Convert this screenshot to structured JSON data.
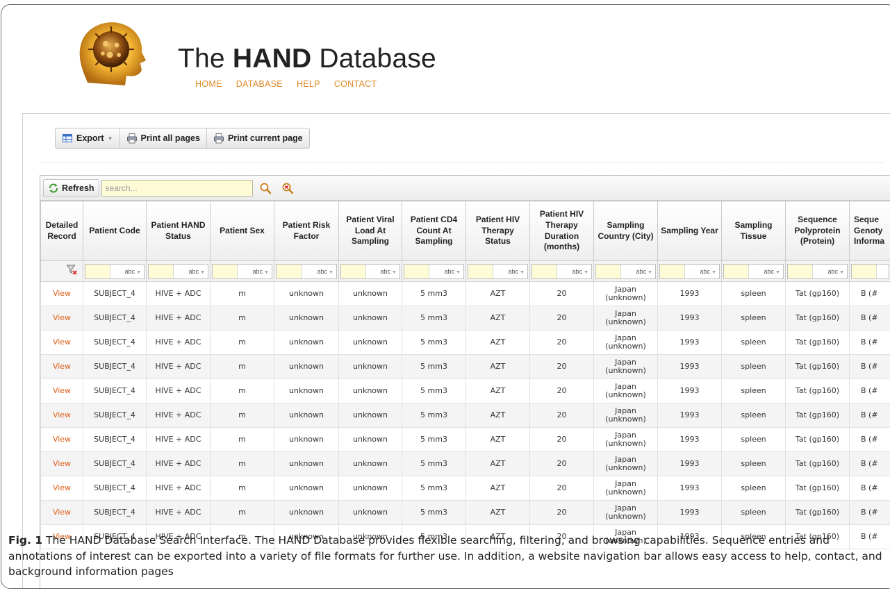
{
  "site": {
    "title_prefix": "The",
    "title_bold": "HAND",
    "title_suffix": "Database",
    "nav": [
      "HOME",
      "DATABASE",
      "HELP",
      "CONTACT"
    ]
  },
  "export_toolbar": {
    "export_label": "Export",
    "print_all_label": "Print all pages",
    "print_current_label": "Print current page"
  },
  "grid_toolbar": {
    "refresh_label": "Refresh",
    "search_placeholder": "search..."
  },
  "filter_operator": "abc",
  "columns": [
    "Detailed Record",
    "Patient Code",
    "Patient HAND Status",
    "Patient Sex",
    "Patient Risk Factor",
    "Patient Viral Load At Sampling",
    "Patient CD4 Count At Sampling",
    "Patient HIV Therapy Status",
    "Patient HIV Therapy Duration (months)",
    "Sampling Country (City)",
    "Sampling Year",
    "Sampling Tissue",
    "Sequence Polyprotein (Protein)",
    "Seque Genoty Informa"
  ],
  "rows": [
    [
      "View",
      "SUBJECT_4",
      "HIVE + ADC",
      "m",
      "unknown",
      "unknown",
      "5 mm3",
      "AZT",
      "20",
      "Japan",
      "(unknown)",
      "1993",
      "spleen",
      "Tat (gp160)",
      "B (#"
    ],
    [
      "View",
      "SUBJECT_4",
      "HIVE + ADC",
      "m",
      "unknown",
      "unknown",
      "5 mm3",
      "AZT",
      "20",
      "Japan",
      "(unknown)",
      "1993",
      "spleen",
      "Tat (gp160)",
      "B (#"
    ],
    [
      "View",
      "SUBJECT_4",
      "HIVE + ADC",
      "m",
      "unknown",
      "unknown",
      "5 mm3",
      "AZT",
      "20",
      "Japan",
      "(unknown)",
      "1993",
      "spleen",
      "Tat (gp160)",
      "B (#"
    ],
    [
      "View",
      "SUBJECT_4",
      "HIVE + ADC",
      "m",
      "unknown",
      "unknown",
      "5 mm3",
      "AZT",
      "20",
      "Japan",
      "(unknown)",
      "1993",
      "spleen",
      "Tat (gp160)",
      "B (#"
    ],
    [
      "View",
      "SUBJECT_4",
      "HIVE + ADC",
      "m",
      "unknown",
      "unknown",
      "5 mm3",
      "AZT",
      "20",
      "Japan",
      "(unknown)",
      "1993",
      "spleen",
      "Tat (gp160)",
      "B (#"
    ],
    [
      "View",
      "SUBJECT_4",
      "HIVE + ADC",
      "m",
      "unknown",
      "unknown",
      "5 mm3",
      "AZT",
      "20",
      "Japan",
      "(unknown)",
      "1993",
      "spleen",
      "Tat (gp160)",
      "B (#"
    ],
    [
      "View",
      "SUBJECT_4",
      "HIVE + ADC",
      "m",
      "unknown",
      "unknown",
      "5 mm3",
      "AZT",
      "20",
      "Japan",
      "(unknown)",
      "1993",
      "spleen",
      "Tat (gp160)",
      "B (#"
    ],
    [
      "View",
      "SUBJECT_4",
      "HIVE + ADC",
      "m",
      "unknown",
      "unknown",
      "5 mm3",
      "AZT",
      "20",
      "Japan",
      "(unknown)",
      "1993",
      "spleen",
      "Tat (gp160)",
      "B (#"
    ],
    [
      "View",
      "SUBJECT_4",
      "HIVE + ADC",
      "m",
      "unknown",
      "unknown",
      "5 mm3",
      "AZT",
      "20",
      "Japan",
      "(unknown)",
      "1993",
      "spleen",
      "Tat (gp160)",
      "B (#"
    ],
    [
      "View",
      "SUBJECT_4",
      "HIVE + ADC",
      "m",
      "unknown",
      "unknown",
      "5 mm3",
      "AZT",
      "20",
      "Japan",
      "(unknown)",
      "1993",
      "spleen",
      "Tat (gp160)",
      "B (#"
    ],
    [
      "View",
      "SUBJECT_4",
      "HIVE + ADC",
      "m",
      "unknown",
      "unknown",
      "5 mm3",
      "AZT",
      "20",
      "Japan",
      "(unknown)",
      "1993",
      "spleen",
      "Tat (gp160)",
      "B (#"
    ]
  ],
  "caption": {
    "label": "Fig. 1",
    "text": "The HAND Database Search Interface. The HAND Database provides flexible searching, filtering, and browsing capabilities. Sequence entries and annotations of interest can be exported into a variety of file formats for further use. In addition, a website navigation bar allows easy access to help, contact, and background information pages"
  },
  "colors": {
    "nav_link": "#e08a2a",
    "view_link": "#e0601c",
    "search_bg": "#fffbd6"
  },
  "icons": {
    "logo": "virus-head-logo",
    "export": "spreadsheet-icon",
    "print": "printer-icon",
    "refresh": "refresh-icon",
    "search": "magnifier-icon",
    "clear_search": "magnifier-clear-icon",
    "filter": "funnel-clear-icon"
  }
}
